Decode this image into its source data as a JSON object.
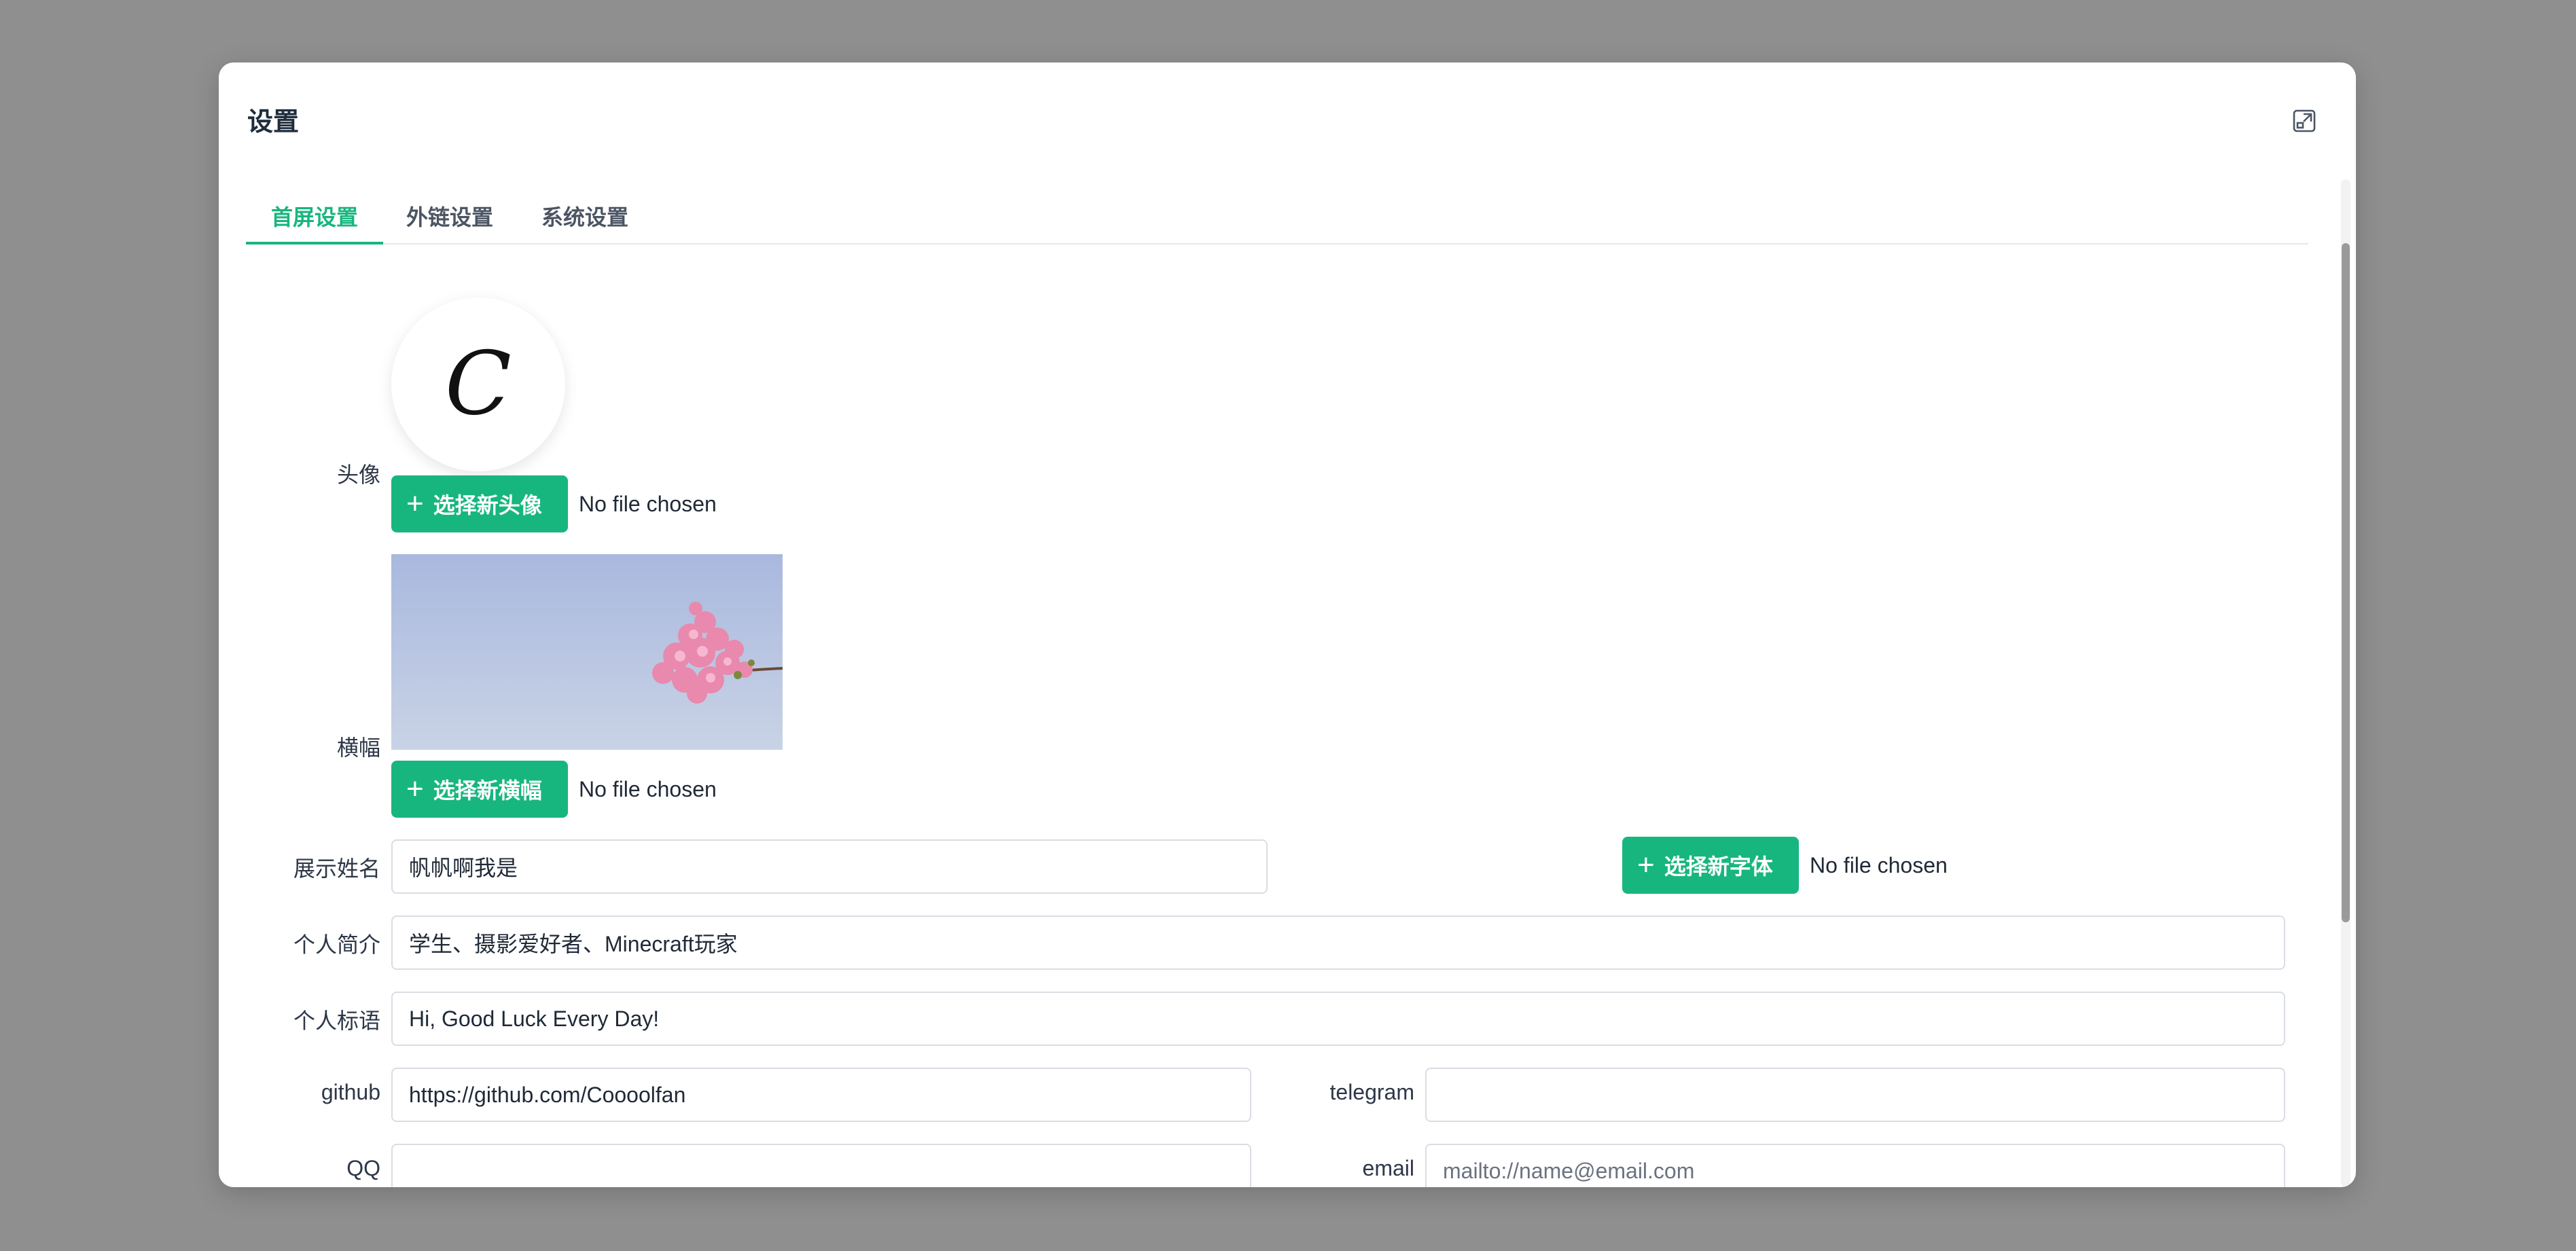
{
  "dialog": {
    "title": "设置",
    "expand_icon": "expand-icon"
  },
  "tabs": [
    {
      "label": "首屏设置",
      "active": true
    },
    {
      "label": "外链设置",
      "active": false
    },
    {
      "label": "系统设置",
      "active": false
    }
  ],
  "form": {
    "avatar": {
      "label": "头像",
      "initial": "C",
      "button_label": "选择新头像",
      "file_status": "No file chosen"
    },
    "banner": {
      "label": "横幅",
      "button_label": "选择新横幅",
      "file_status": "No file chosen"
    },
    "display_name": {
      "label": "展示姓名",
      "value": "帆帆啊我是"
    },
    "font": {
      "button_label": "选择新字体",
      "file_status": "No file chosen"
    },
    "bio": {
      "label": "个人简介",
      "value": "学生、摄影爱好者、Minecraft玩家"
    },
    "slogan": {
      "label": "个人标语",
      "value": "Hi, Good Luck Every Day!"
    },
    "github": {
      "label": "github",
      "value": "https://github.com/Coooolfan"
    },
    "telegram": {
      "label": "telegram",
      "value": ""
    },
    "qq": {
      "label": "QQ",
      "value": ""
    },
    "email": {
      "label": "email",
      "value": "",
      "placeholder": "mailto://name@email.com"
    }
  },
  "colors": {
    "accent": "#18b67f",
    "backdrop": "#8f8f8f",
    "text": "#1f2937"
  }
}
